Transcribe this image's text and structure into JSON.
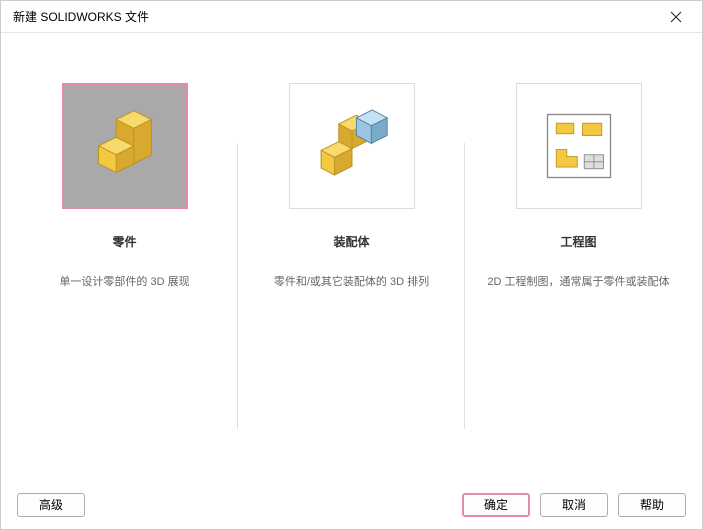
{
  "titlebar": {
    "title": "新建 SOLIDWORKS 文件"
  },
  "options": {
    "part": {
      "title": "零件",
      "desc": "单一设计零部件的 3D 展现",
      "selected": true
    },
    "assembly": {
      "title": "装配体",
      "desc": "零件和/或其它装配体的 3D 排列",
      "selected": false
    },
    "drawing": {
      "title": "工程图",
      "desc": "2D 工程制图，通常属于零件或装配体",
      "selected": false
    }
  },
  "buttons": {
    "advanced": "高级",
    "ok": "确定",
    "cancel": "取消",
    "help": "帮助"
  }
}
